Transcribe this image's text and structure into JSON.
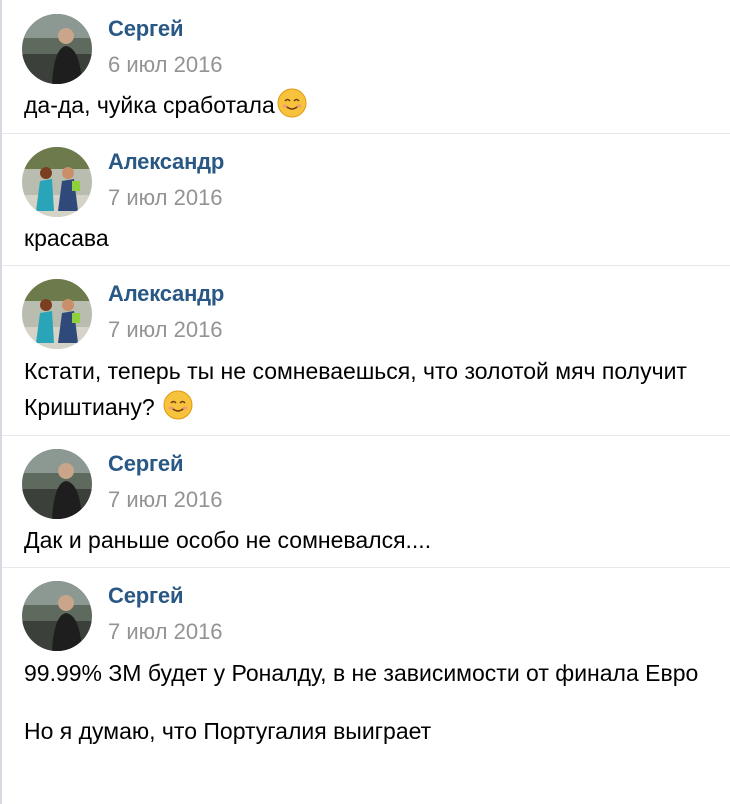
{
  "comments": [
    {
      "author": "Сергей",
      "date": "6 июл 2016",
      "lines": [
        "да-да, чуйка сработала"
      ],
      "emoji": "smiling-emoji",
      "avatar": "sergey"
    },
    {
      "author": "Александр",
      "date": "7 июл 2016",
      "lines": [
        "красава"
      ],
      "emoji": null,
      "avatar": "alexander"
    },
    {
      "author": "Александр",
      "date": "7 июл 2016",
      "lines": [
        "Кстати, теперь ты не сомневаешься, что золотой мяч получит Криштиану?"
      ],
      "emoji": "smiling-emoji",
      "avatar": "alexander"
    },
    {
      "author": "Сергей",
      "date": "7 июл 2016",
      "lines": [
        "Дак и раньше особо не сомневался...."
      ],
      "emoji": null,
      "avatar": "sergey"
    },
    {
      "author": "Сергей",
      "date": "7 июл 2016",
      "lines": [
        "99.99% ЗМ будет у Роналду, в не зависимости от финала Евро",
        "Но я думаю, что Португалия выиграет"
      ],
      "emoji": null,
      "avatar": "sergey"
    }
  ],
  "colors": {
    "author": "#2a5885",
    "date": "#939393",
    "divider": "#e7e8ec"
  }
}
